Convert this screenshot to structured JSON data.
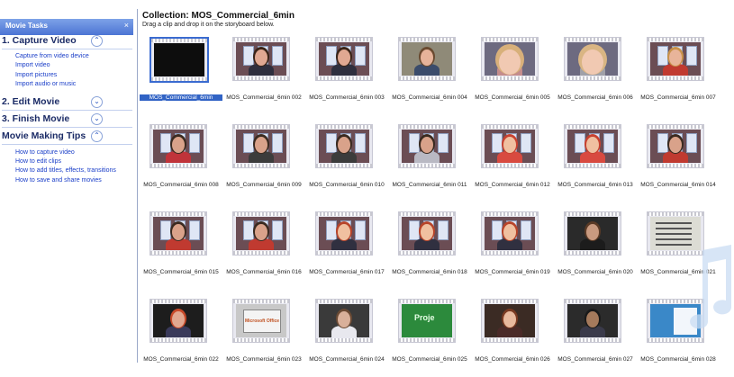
{
  "tasks_pane": {
    "title": "Movie Tasks",
    "close": "×",
    "sections": [
      {
        "title": "1. Capture Video",
        "toggle": "⌃",
        "links": [
          "Capture from video device",
          "Import video",
          "Import pictures",
          "Import audio or music"
        ]
      },
      {
        "title": "2. Edit Movie",
        "toggle": "⌄"
      },
      {
        "title": "3. Finish Movie",
        "toggle": "⌄"
      },
      {
        "title": "Movie Making Tips",
        "toggle": "⌃",
        "links": [
          "How to capture video",
          "How to edit clips",
          "How to add titles, effects, transitions",
          "How to save and share movies"
        ]
      }
    ]
  },
  "collection": {
    "title": "Collection: MOS_Commercial_6min",
    "subtitle": "Drag a clip and drop it on the storyboard below.",
    "clips": [
      "MOS_Commercial_6min",
      "MOS_Commercial_6min 002",
      "MOS_Commercial_6min 003",
      "MOS_Commercial_6min 004",
      "MOS_Commercial_6min 005",
      "MOS_Commercial_6min 006",
      "MOS_Commercial_6min 007",
      "MOS_Commercial_6min 008",
      "MOS_Commercial_6min 009",
      "MOS_Commercial_6min 010",
      "MOS_Commercial_6min 011",
      "MOS_Commercial_6min 012",
      "MOS_Commercial_6min 013",
      "MOS_Commercial_6min 014",
      "MOS_Commercial_6min 015",
      "MOS_Commercial_6min 016",
      "MOS_Commercial_6min 017",
      "MOS_Commercial_6min 018",
      "MOS_Commercial_6min 019",
      "MOS_Commercial_6min 020",
      "MOS_Commercial_6min 021",
      "MOS_Commercial_6min 022",
      "MOS_Commercial_6min 023",
      "MOS_Commercial_6min 024",
      "MOS_Commercial_6min 025",
      "MOS_Commercial_6min 026",
      "MOS_Commercial_6min 027",
      "MOS_Commercial_6min 028"
    ],
    "selected_clip": "MOS_Commercial_6min",
    "thumb_texts": {
      "office_card": "Microsoft Office",
      "green_card": "Proje"
    }
  },
  "colors": {
    "header_blue": "#4c74d4",
    "link_blue": "#1a3ec8",
    "selection_blue": "#3163c5"
  }
}
